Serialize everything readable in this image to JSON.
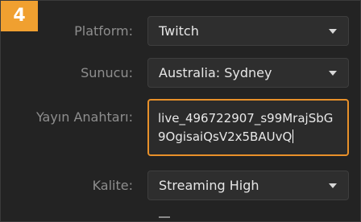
{
  "step": {
    "number": "4"
  },
  "fields": {
    "platform": {
      "label": "Platform:",
      "value": "Twitch"
    },
    "server": {
      "label": "Sunucu:",
      "value": "Australia: Sydney"
    },
    "stream_key": {
      "label": "Yayın Anahtarı:",
      "value": "live_496722907_s99MrajSbG9OgisaiQsV2x5BAUvQ"
    },
    "quality": {
      "label": "Kalite:",
      "value": "Streaming High"
    }
  },
  "icons": {
    "dropdown": "chevron-down-icon"
  },
  "colors": {
    "accent": "#f0a030",
    "focus_border": "#e8902a",
    "label": "#8e8e8e",
    "value": "#e6e6e6"
  }
}
